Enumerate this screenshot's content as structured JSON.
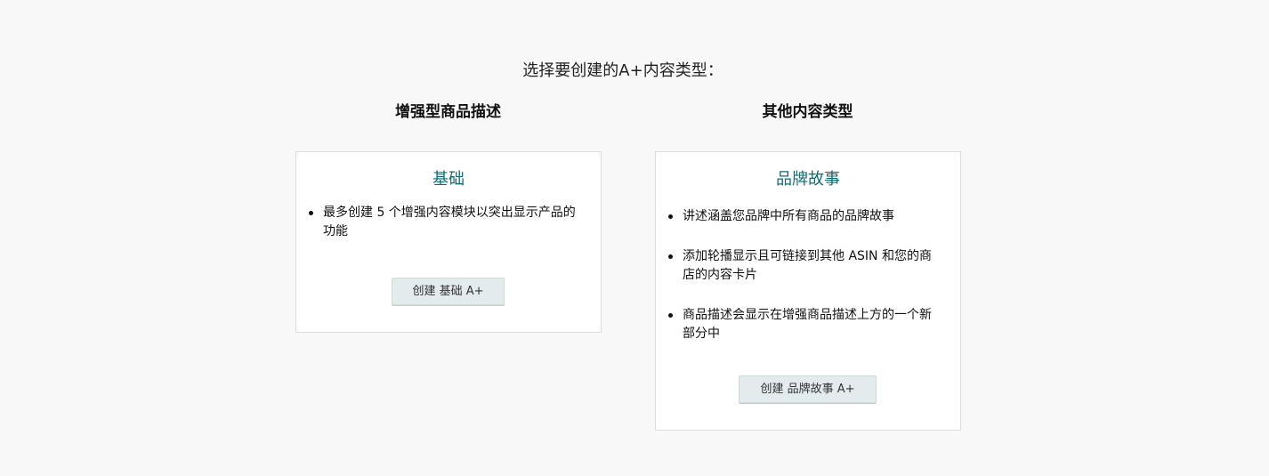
{
  "page": {
    "title": "选择要创建的A+内容类型："
  },
  "sections": {
    "enhanced": {
      "heading": "增强型商品描述",
      "card": {
        "title": "基础",
        "bullets": [
          "最多创建 5 个增强内容模块以突出显示产品的功能"
        ],
        "button_label": "创建 基础 A+"
      }
    },
    "other": {
      "heading": "其他内容类型",
      "card": {
        "title": "品牌故事",
        "bullets": [
          "讲述涵盖您品牌中所有商品的品牌故事",
          "添加轮播显示且可链接到其他 ASIN 和您的商店的内容卡片",
          "商品描述会显示在增强商品描述上方的一个新部分中"
        ],
        "button_label": "创建 品牌故事 A+"
      }
    }
  },
  "colors": {
    "background": "#f8f8f8",
    "card_title": "#106c73",
    "button_bg": "#e3ebec",
    "card_border": "#dddddd"
  }
}
